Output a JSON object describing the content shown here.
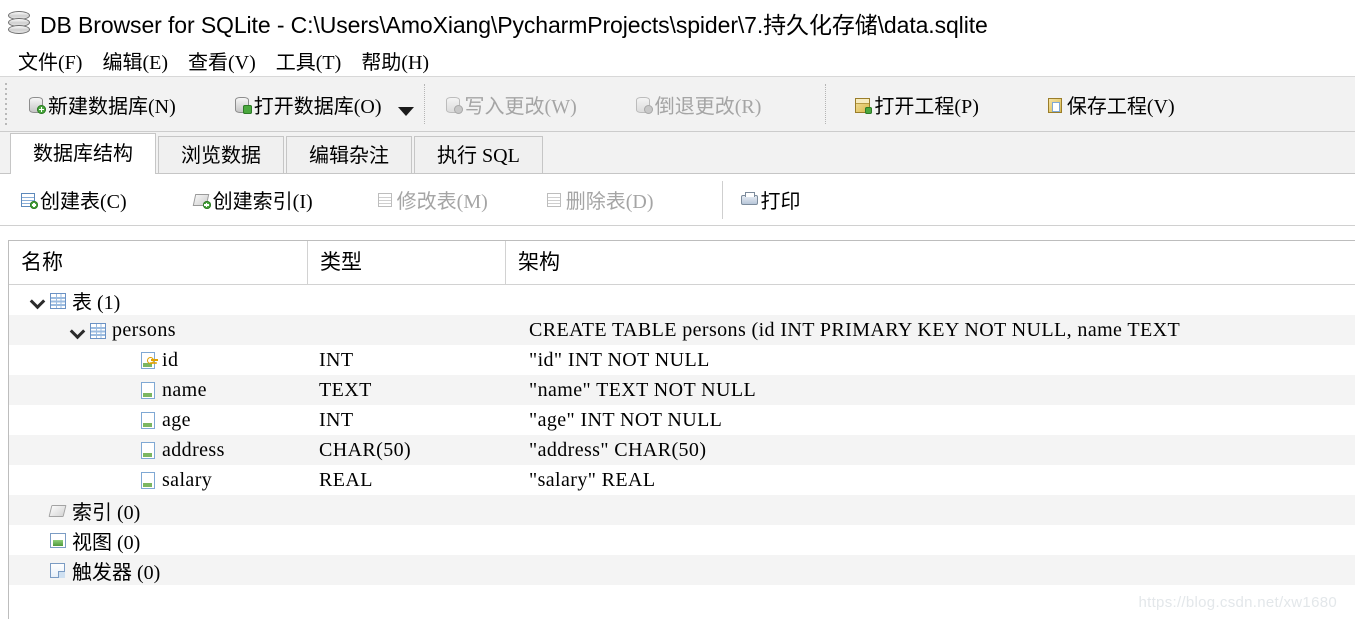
{
  "window": {
    "icon": "database-icon",
    "title": "DB Browser for SQLite - C:\\Users\\AmoXiang\\PycharmProjects\\spider\\7.持久化存储\\data.sqlite"
  },
  "menubar": {
    "items": [
      {
        "label": "文件(F)"
      },
      {
        "label": "编辑(E)"
      },
      {
        "label": "查看(V)"
      },
      {
        "label": "工具(T)"
      },
      {
        "label": "帮助(H)"
      }
    ]
  },
  "toolbar": {
    "buttons": [
      {
        "label": "新建数据库(N)",
        "icon": "new-database-icon",
        "enabled": true
      },
      {
        "label": "打开数据库(O)",
        "icon": "open-database-icon",
        "enabled": true
      },
      {
        "label": "写入更改(W)",
        "icon": "write-changes-icon",
        "enabled": false
      },
      {
        "label": "倒退更改(R)",
        "icon": "revert-changes-icon",
        "enabled": false
      },
      {
        "label": "打开工程(P)",
        "icon": "open-project-icon",
        "enabled": true
      },
      {
        "label": "保存工程(V)",
        "icon": "save-project-icon",
        "enabled": true
      }
    ]
  },
  "tabs": [
    {
      "label": "数据库结构",
      "active": true
    },
    {
      "label": "浏览数据",
      "active": false
    },
    {
      "label": "编辑杂注",
      "active": false
    },
    {
      "label": "执行 SQL",
      "active": false
    }
  ],
  "subtoolbar": {
    "buttons": [
      {
        "label": "创建表(C)",
        "icon": "create-table-icon",
        "enabled": true
      },
      {
        "label": "创建索引(I)",
        "icon": "create-index-icon",
        "enabled": true
      },
      {
        "label": "修改表(M)",
        "icon": "modify-table-icon",
        "enabled": false
      },
      {
        "label": "删除表(D)",
        "icon": "delete-table-icon",
        "enabled": false
      },
      {
        "label": "打印",
        "icon": "print-icon",
        "enabled": true
      }
    ]
  },
  "tree": {
    "columns": [
      {
        "label": "名称"
      },
      {
        "label": "类型"
      },
      {
        "label": "架构"
      }
    ],
    "rows": [
      {
        "name": "表 (1)",
        "type": "",
        "schema": "",
        "icon": "table-group-icon",
        "indent": 0,
        "twisty": "expanded"
      },
      {
        "name": "persons",
        "type": "",
        "schema": "CREATE TABLE persons (id INT PRIMARY KEY NOT NULL, name TEXT",
        "icon": "table-icon",
        "indent": 1,
        "twisty": "expanded"
      },
      {
        "name": "id",
        "type": "INT",
        "schema": "\"id\" INT NOT NULL",
        "icon": "primary-key-field-icon",
        "indent": 2,
        "twisty": "none"
      },
      {
        "name": "name",
        "type": "TEXT",
        "schema": "\"name\" TEXT NOT NULL",
        "icon": "field-icon",
        "indent": 2,
        "twisty": "none"
      },
      {
        "name": "age",
        "type": "INT",
        "schema": "\"age\" INT NOT NULL",
        "icon": "field-icon",
        "indent": 2,
        "twisty": "none"
      },
      {
        "name": "address",
        "type": "CHAR(50)",
        "schema": "\"address\" CHAR(50)",
        "icon": "field-icon",
        "indent": 2,
        "twisty": "none"
      },
      {
        "name": "salary",
        "type": "REAL",
        "schema": "\"salary\" REAL",
        "icon": "field-icon",
        "indent": 2,
        "twisty": "none"
      },
      {
        "name": "索引 (0)",
        "type": "",
        "schema": "",
        "icon": "index-group-icon",
        "indent": 0,
        "twisty": "none"
      },
      {
        "name": "视图 (0)",
        "type": "",
        "schema": "",
        "icon": "view-group-icon",
        "indent": 0,
        "twisty": "none"
      },
      {
        "name": "触发器 (0)",
        "type": "",
        "schema": "",
        "icon": "trigger-group-icon",
        "indent": 0,
        "twisty": "none"
      }
    ]
  },
  "watermark": "https://blog.csdn.net/xw1680",
  "colors": {
    "toolbar_bg": "#f2f2f2",
    "stripe": "#f4f4f4",
    "disabled_text": "#a5a5a5",
    "border": "#bdbdbd"
  }
}
